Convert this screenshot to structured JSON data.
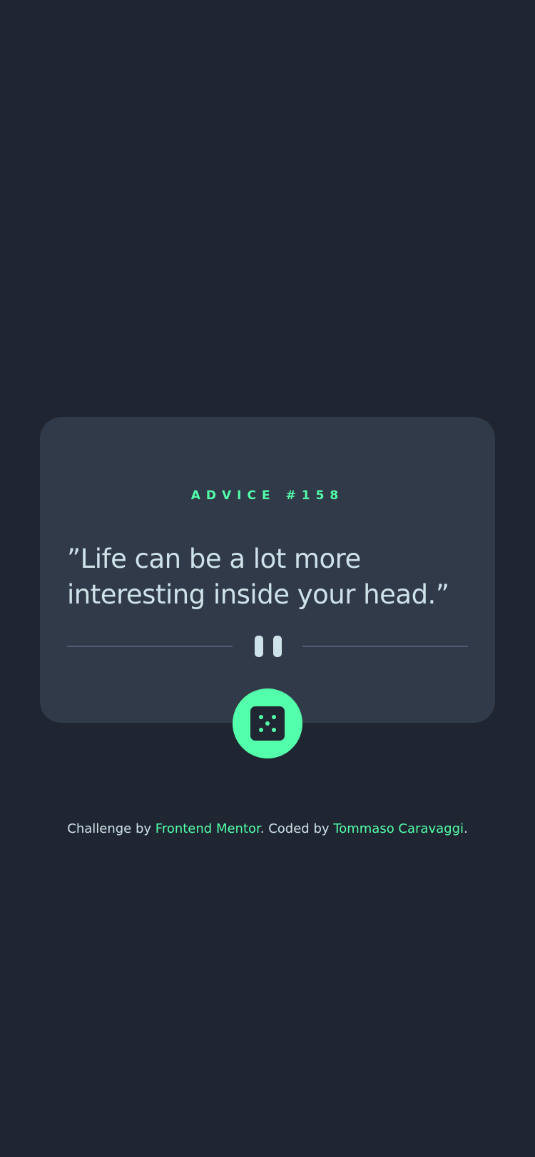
{
  "card": {
    "advice_label": "Advice #158",
    "quote": "”Life can be a lot more interesting inside your head.”"
  },
  "icons": {
    "divider": "pause-icon",
    "button": "dice-icon"
  },
  "footer": {
    "prefix": "Challenge by ",
    "link1": "Frontend Mentor",
    "middle": ". Coded by ",
    "link2": "Tommaso Caravaggi",
    "suffix": "."
  },
  "colors": {
    "background": "#1f2632",
    "card": "#313a49",
    "accent": "#53ffaa",
    "text": "#cee3e9",
    "divider": "#4e5d73"
  }
}
